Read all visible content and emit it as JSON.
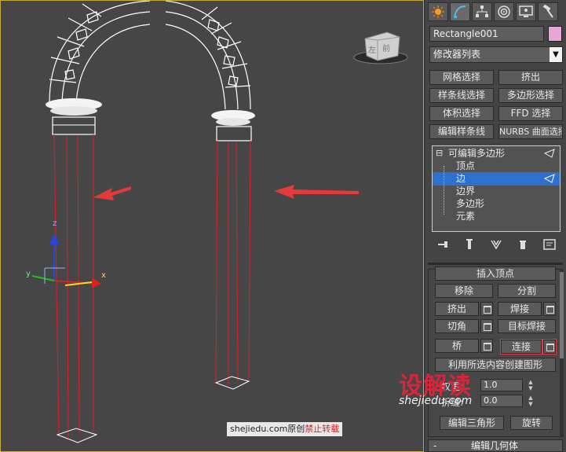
{
  "viewport": {
    "caption_prefix": "shejiedu.com原创",
    "caption_suffix": "禁止转载",
    "viewcube_labels": [
      "左",
      "前"
    ],
    "axis_labels": {
      "x": "x",
      "y": "y",
      "z": "z"
    }
  },
  "panel": {
    "tabs": [
      {
        "name": "create-tab",
        "icon": "sun-icon"
      },
      {
        "name": "modify-tab",
        "icon": "curve-icon"
      },
      {
        "name": "hierarchy-tab",
        "icon": "hierarchy-icon"
      },
      {
        "name": "motion-tab",
        "icon": "motion-icon"
      },
      {
        "name": "display-tab",
        "icon": "monitor-icon"
      },
      {
        "name": "utilities-tab",
        "icon": "hammer-icon"
      }
    ],
    "object_name": "Rectangle001",
    "object_color": "#e7a6d6",
    "modifier_list": "修改器列表",
    "modifier_buttons": [
      "网格选择",
      "挤出",
      "样条线选择",
      "多边形选择",
      "体积选择",
      "FFD 选择",
      "编辑样条线",
      "NURBS 曲面选择"
    ],
    "stack": {
      "root": "可编辑多边形",
      "items": [
        "顶点",
        "边",
        "边界",
        "多边形",
        "元素"
      ],
      "selected": "边"
    },
    "edit_edges": {
      "top_cut": "插入顶点",
      "remove": "移除",
      "split": "分割",
      "extrude": "挤出",
      "weld": "焊接",
      "chamfer": "切角",
      "target_weld": "目标焊接",
      "bridge": "桥",
      "connect": "连接",
      "create_shape": "利用所选内容创建图形",
      "weight_label": "权重:",
      "weight_value": "1.0",
      "crease_label": "折缝:",
      "crease_value": "0.0",
      "edit_tri": "编辑三角形",
      "rotate": "旋转"
    },
    "next_rollout": "编辑几何体",
    "next_rollout_sign": "-"
  },
  "watermark": {
    "big": "设解读",
    "small": "shejiedu.com"
  },
  "colors": {
    "accent": "#2f6fce",
    "edge_red": "#d0202a",
    "viewport_border": "#c8a93a"
  }
}
